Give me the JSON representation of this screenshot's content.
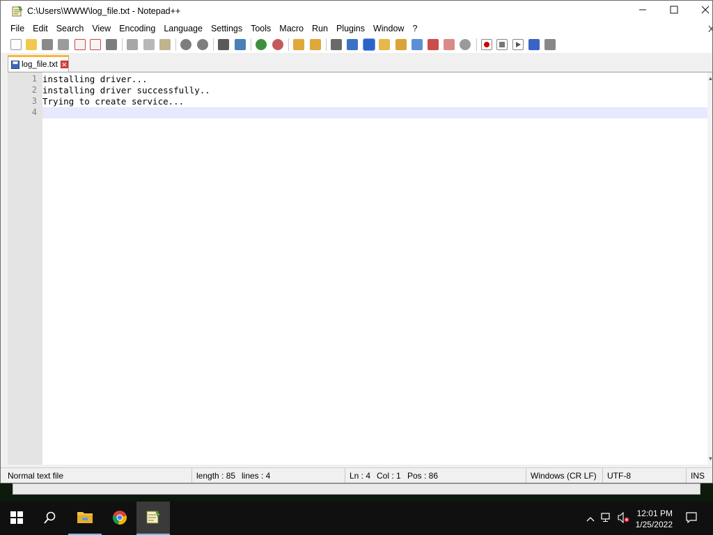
{
  "window": {
    "title": "C:\\Users\\WWW\\log_file.txt - Notepad++",
    "minimize_icon": "minimize-icon",
    "maximize_icon": "maximize-icon",
    "close_icon": "close-icon"
  },
  "menu": {
    "items": [
      "File",
      "Edit",
      "Search",
      "View",
      "Encoding",
      "Language",
      "Settings",
      "Tools",
      "Macro",
      "Run",
      "Plugins",
      "Window",
      "?"
    ],
    "close_glyph": "X"
  },
  "toolbar": {
    "icons": [
      "new-file-icon",
      "open-file-icon",
      "save-icon",
      "save-all-icon",
      "close-icon",
      "close-all-icon",
      "print-icon",
      "cut-icon",
      "copy-icon",
      "paste-icon",
      "undo-icon",
      "redo-icon",
      "find-icon",
      "replace-icon",
      "zoom-in-icon",
      "zoom-out-icon",
      "sync-vertical-icon",
      "sync-horizontal-icon",
      "word-wrap-icon",
      "show-all-chars-icon",
      "indent-guide-icon",
      "user-defined-language-icon",
      "document-map-icon",
      "function-list-icon",
      "folder-as-workspace-icon",
      "monitoring-icon",
      "record-macro-icon",
      "stop-macro-icon",
      "play-macro-icon",
      "run-macro-multiple-icon",
      "save-macro-icon"
    ]
  },
  "tab": {
    "label": "log_file.txt",
    "close_glyph": "✕"
  },
  "editor": {
    "lines": [
      {
        "num": "1",
        "text": "installing driver..."
      },
      {
        "num": "2",
        "text": "installing driver successfully.."
      },
      {
        "num": "3",
        "text": "Trying to create service..."
      },
      {
        "num": "4",
        "text": ""
      }
    ]
  },
  "status": {
    "file_type": "Normal text file",
    "length": "length : 85",
    "lines": "lines : 4",
    "ln": "Ln : 4",
    "col": "Col : 1",
    "pos": "Pos : 86",
    "eol": "Windows (CR LF)",
    "encoding": "UTF-8",
    "mode": "INS"
  },
  "taskbar": {
    "apps": [
      "start-icon",
      "search-icon",
      "file-explorer-icon",
      "chrome-icon",
      "notepad-plus-plus-icon"
    ],
    "time": "12:01 PM",
    "date": "1/25/2022"
  },
  "colors": {
    "accent_tab": "#fab73b",
    "current_line": "#e8e8ff",
    "taskbar": "#101010"
  }
}
